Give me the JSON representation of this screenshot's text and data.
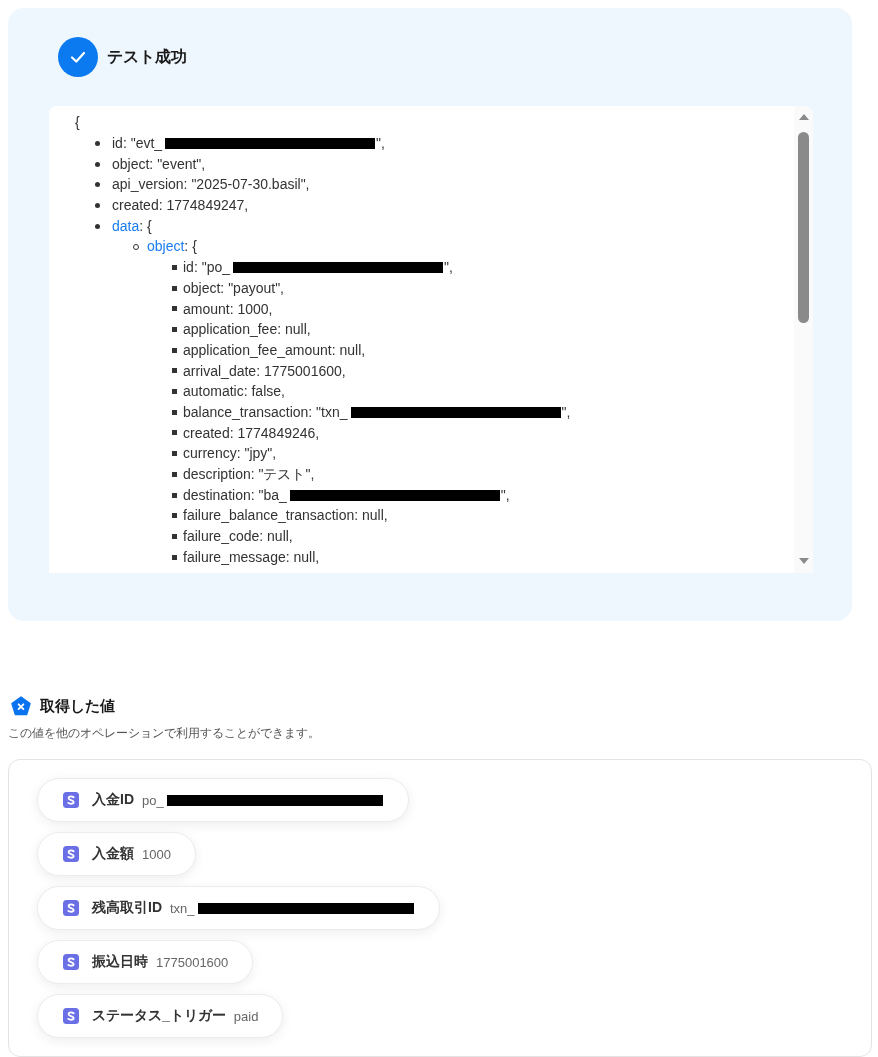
{
  "result": {
    "title": "テスト成功"
  },
  "code_view": {
    "open_brace": "{",
    "items": [
      {
        "kind": "redacted",
        "text": "id: \"evt_",
        "tail": "\","
      },
      {
        "kind": "field",
        "text": "object: \"event\","
      },
      {
        "kind": "field",
        "text": "api_version: \"2025-07-30.basil\","
      },
      {
        "kind": "field",
        "text": "created: 1774849247,"
      },
      {
        "kind": "branch",
        "key": "data",
        "text": ": {",
        "children": [
          {
            "kind": "branch",
            "key": "object",
            "text": ": {",
            "children": [
              {
                "kind": "redacted",
                "text": "id: \"po_",
                "tail": "\","
              },
              {
                "kind": "field",
                "text": "object: \"payout\","
              },
              {
                "kind": "field",
                "text": "amount: 1000,"
              },
              {
                "kind": "field",
                "text": "application_fee: null,"
              },
              {
                "kind": "field",
                "text": "application_fee_amount: null,"
              },
              {
                "kind": "field",
                "text": "arrival_date: 1775001600,"
              },
              {
                "kind": "field",
                "text": "automatic: false,"
              },
              {
                "kind": "redacted",
                "text": "balance_transaction: \"txn_",
                "tail": "\","
              },
              {
                "kind": "field",
                "text": "created: 1774849246,"
              },
              {
                "kind": "field",
                "text": "currency: \"jpy\","
              },
              {
                "kind": "field",
                "text": "description: \"テスト\","
              },
              {
                "kind": "redacted",
                "text": "destination: \"ba_",
                "tail": "\","
              },
              {
                "kind": "field",
                "text": "failure_balance_transaction: null,"
              },
              {
                "kind": "field",
                "text": "failure_code: null,"
              },
              {
                "kind": "field",
                "text": "failure_message: null,"
              }
            ]
          }
        ]
      }
    ]
  },
  "values": {
    "title": "取得した値",
    "description": "この値を他のオペレーションで利用することができます。",
    "items": [
      {
        "label": "入金ID",
        "value": "po_",
        "redacted": true
      },
      {
        "label": "入金額",
        "value": "1000",
        "redacted": false
      },
      {
        "label": "残高取引ID",
        "value": "txn_",
        "redacted": true
      },
      {
        "label": "振込日時",
        "value": "1775001600",
        "redacted": false
      },
      {
        "label": "ステータス_トリガー",
        "value": "paid",
        "redacted": false
      }
    ]
  }
}
